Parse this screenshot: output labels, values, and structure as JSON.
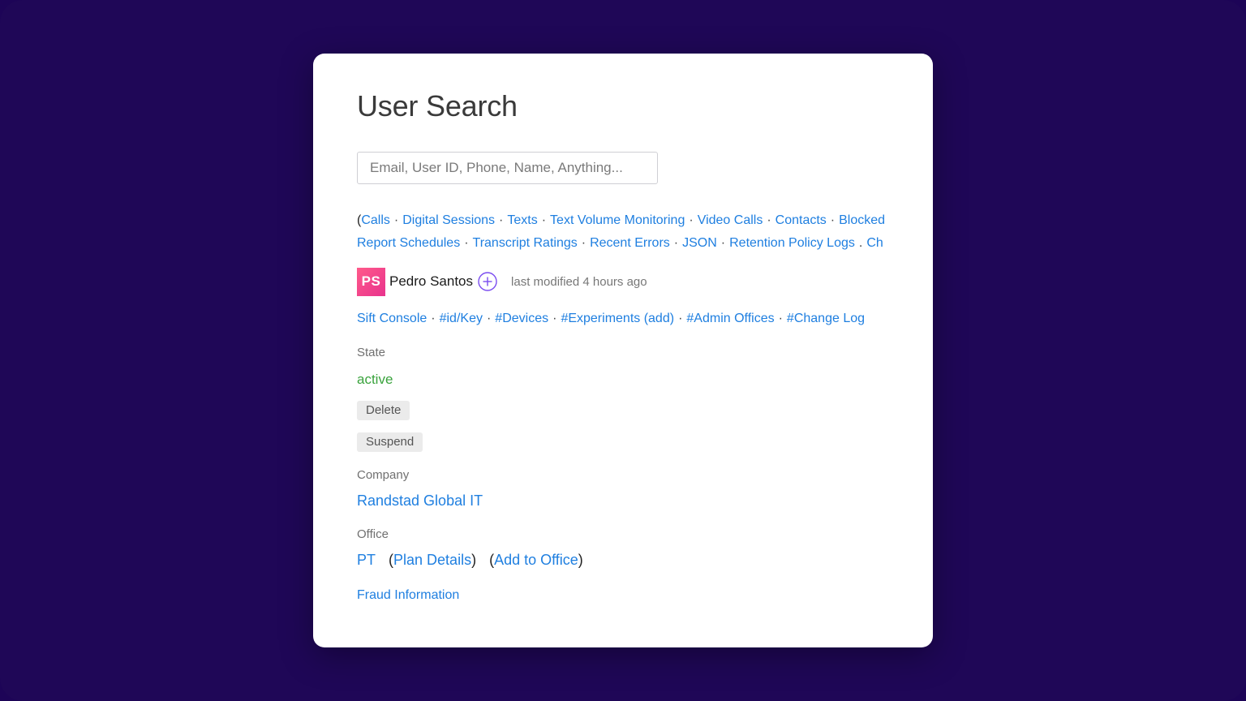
{
  "page": {
    "title": "User Search",
    "search_placeholder": "Email, User ID, Phone, Name, Anything...",
    "search_value": ""
  },
  "nav_links_row1": {
    "open_paren": "(",
    "links": [
      "Calls",
      "Digital Sessions",
      "Texts",
      "Text Volume Monitoring",
      "Video Calls",
      "Contacts",
      "Blocked"
    ]
  },
  "nav_links_row2": {
    "links": [
      "Report Schedules",
      "Transcript Ratings",
      "Recent Errors",
      "JSON",
      "Retention Policy Logs"
    ],
    "trailing_sep": ".",
    "trailing_link": "Ch"
  },
  "separator": "·",
  "user": {
    "initials": "PS",
    "name": "Pedro Santos",
    "last_modified": "last modified 4 hours ago",
    "avatar_colors": [
      "#ff5a8a",
      "#e8338d"
    ]
  },
  "user_links": [
    "Sift Console",
    "#id/Key",
    "#Devices",
    "#Experiments (add)",
    "#Admin Offices",
    "#Change Log"
  ],
  "state": {
    "label": "State",
    "value": "active",
    "value_color": "#3aa33d",
    "delete_label": "Delete",
    "suspend_label": "Suspend"
  },
  "company": {
    "label": "Company",
    "value": "Randstad Global IT"
  },
  "office": {
    "label": "Office",
    "code": "PT",
    "plan_details": "Plan Details",
    "add_to_office": "Add to Office",
    "open_paren": "(",
    "close_paren": ")"
  },
  "fraud_link": "Fraud Information",
  "colors": {
    "background": "#1f0757",
    "link": "#1f7fe0",
    "card": "#ffffff",
    "accent_purple": "#7a4cf0"
  }
}
